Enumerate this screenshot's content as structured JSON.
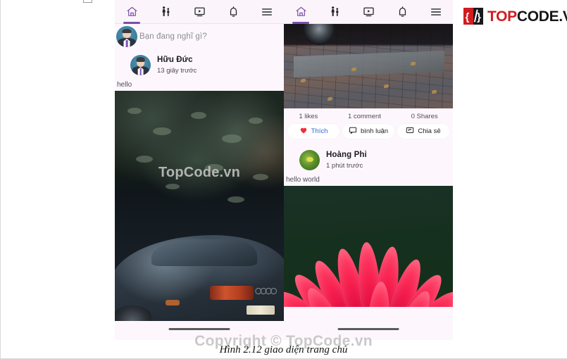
{
  "document": {
    "caption": "Hình 2.12 giao diện trang chủ",
    "watermark_bottom": "Copyright © TopCode.vn",
    "watermark_image": "TopCode.vn"
  },
  "logo": {
    "mark_glyph": "{/}",
    "part_top": "TOP",
    "part_code": "CODE",
    "part_vn": ".VN",
    "red": "#d01d21",
    "black": "#17171b"
  },
  "navbar": {
    "accent": "#7b4fa8",
    "items": [
      {
        "name": "home-icon",
        "label": "Trang chủ",
        "active": true
      },
      {
        "name": "friends-icon",
        "label": "Bạn bè",
        "active": false
      },
      {
        "name": "video-icon",
        "label": "Video",
        "active": false
      },
      {
        "name": "bell-icon",
        "label": "Thông báo",
        "active": false
      },
      {
        "name": "menu-icon",
        "label": "Menu",
        "active": false
      }
    ]
  },
  "left_phone": {
    "composer": {
      "placeholder": "Bạn đang nghĩ gì?"
    },
    "post": {
      "author": "Hữu Đức",
      "time": "13 giây trước",
      "text": "hello",
      "image_alt": "dark forest and sports car at night"
    }
  },
  "right_phone": {
    "post_top": {
      "image_alt": "car tire on brick pavement",
      "stats": {
        "likes": "1 likes",
        "comments": "1 comment",
        "shares": "0 Shares"
      },
      "actions": [
        {
          "name": "like-button",
          "icon": "heart-icon",
          "label": "Thích"
        },
        {
          "name": "comment-button",
          "icon": "comment-icon",
          "label": "bình luận"
        },
        {
          "name": "share-button",
          "icon": "share-icon",
          "label": "Chia sẻ"
        }
      ]
    },
    "post_bottom": {
      "author": "Hoàng Phi",
      "time": "1 phút trước",
      "text": "hello world",
      "image_alt": "pink flower on dark green background"
    }
  },
  "colors": {
    "app_background": "#fdf7fd",
    "nav_background": "#fbf4fb",
    "like_text": "#2a6ad4",
    "heart": "#ed2f3f"
  }
}
